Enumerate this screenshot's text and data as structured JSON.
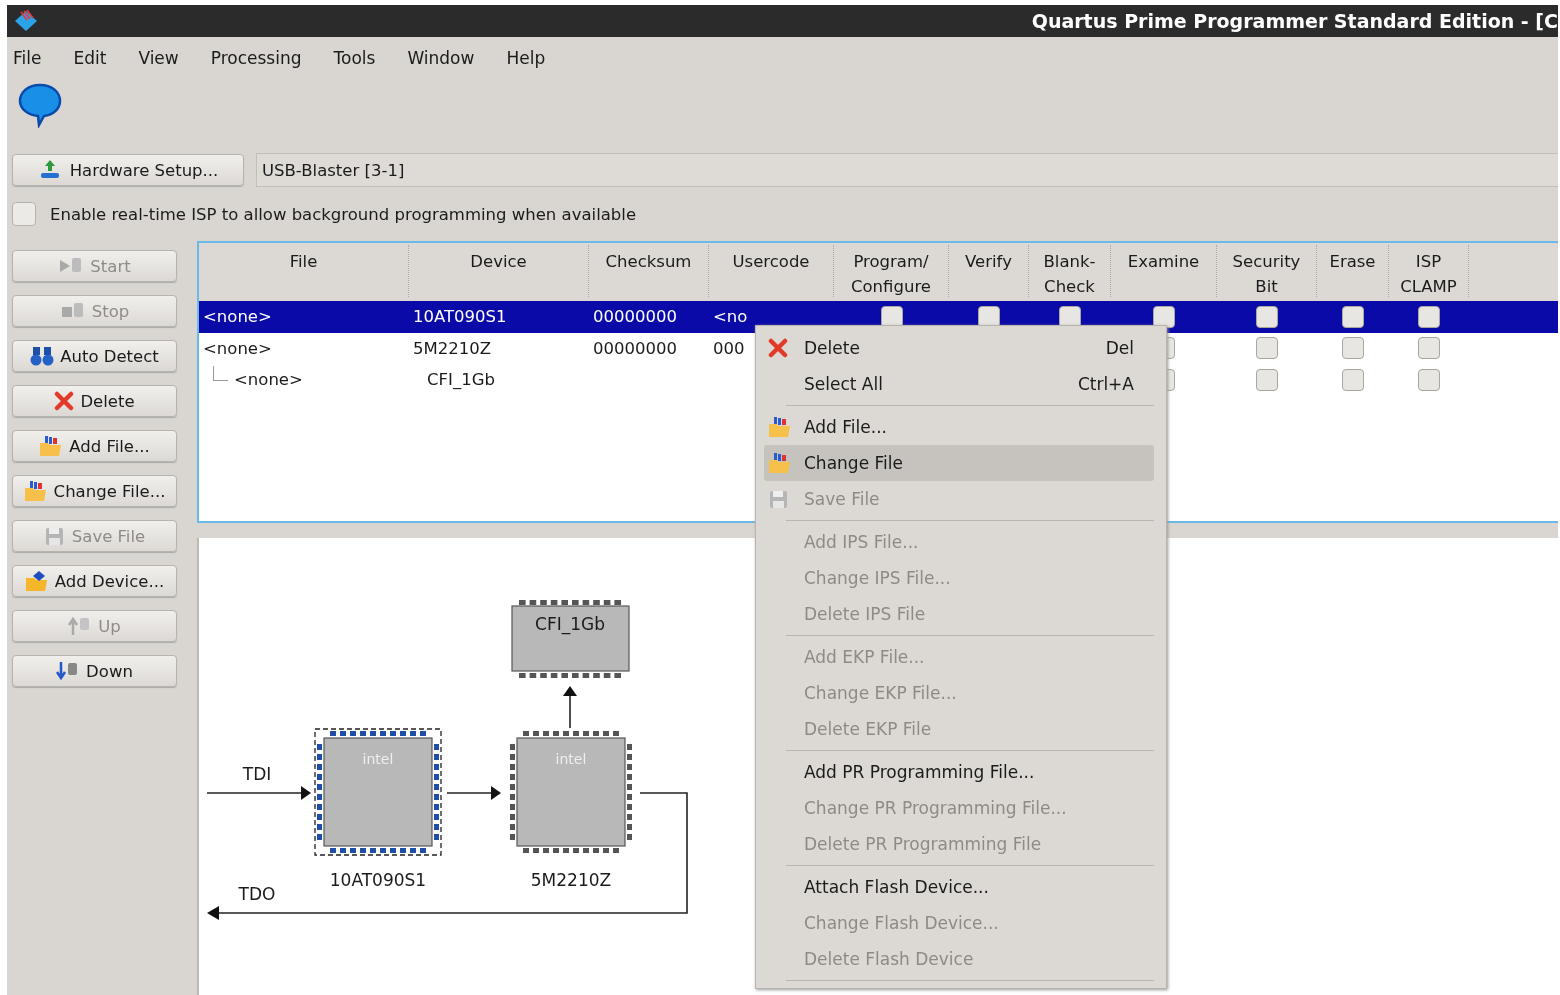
{
  "window": {
    "title": "Quartus Prime Programmer Standard Edition - [C"
  },
  "menu_bar": [
    {
      "label": "File"
    },
    {
      "label": "Edit"
    },
    {
      "label": "View"
    },
    {
      "label": "Processing"
    },
    {
      "label": "Tools"
    },
    {
      "label": "Window"
    },
    {
      "label": "Help"
    }
  ],
  "hardware": {
    "button": "Hardware Setup...",
    "value": "USB-Blaster [3-1]"
  },
  "isp_option": {
    "label": "Enable real-time ISP to allow background programming when available",
    "checked": false
  },
  "side_buttons": [
    {
      "label": "Start",
      "disabled": true
    },
    {
      "label": "Stop",
      "disabled": true
    },
    {
      "label": "Auto Detect",
      "disabled": false
    },
    {
      "label": "Delete",
      "disabled": false
    },
    {
      "label": "Add File...",
      "disabled": false
    },
    {
      "label": "Change File...",
      "disabled": false
    },
    {
      "label": "Save File",
      "disabled": true
    },
    {
      "label": "Add Device...",
      "disabled": false
    },
    {
      "label": "Up",
      "disabled": true
    },
    {
      "label": "Down",
      "disabled": false
    }
  ],
  "table": {
    "columns": [
      "File",
      "Device",
      "Checksum",
      "Usercode",
      "Program/\nConfigure",
      "Verify",
      "Blank-\nCheck",
      "Examine",
      "Security\nBit",
      "Erase",
      "ISP\nCLAMP"
    ],
    "rows": [
      {
        "file": "<none>",
        "device": "10AT090S1",
        "checksum": "00000000",
        "usercode": "<no",
        "selected": true,
        "checks": [
          false,
          false,
          false,
          false,
          false,
          false,
          false
        ],
        "children": []
      },
      {
        "file": "<none>",
        "device": "5M2210Z",
        "checksum": "00000000",
        "usercode": "000",
        "selected": false,
        "checks": [
          false,
          false,
          false,
          false
        ],
        "children": [
          {
            "file": "<none>",
            "device": "CFI_1Gb",
            "selected": false,
            "checks": [
              false,
              false,
              false,
              false
            ]
          }
        ]
      }
    ]
  },
  "diagram": {
    "signals": [
      {
        "label": "TDI"
      },
      {
        "label": "TDO"
      }
    ],
    "devices": [
      {
        "name": "10AT090S1",
        "logo": "intel",
        "selected": true
      },
      {
        "name": "5M2210Z",
        "logo": "intel",
        "selected": false
      }
    ],
    "flash": {
      "name": "CFI_1Gb"
    }
  },
  "context_menu": [
    {
      "kind": "item",
      "label": "Delete",
      "shortcut": "Del",
      "disabled": false,
      "selected": false
    },
    {
      "kind": "item",
      "label": "Select All",
      "shortcut": "Ctrl+A",
      "disabled": false,
      "selected": false
    },
    {
      "kind": "separator"
    },
    {
      "kind": "item",
      "label": "Add File...",
      "disabled": false,
      "selected": false
    },
    {
      "kind": "item",
      "label": "Change File",
      "disabled": false,
      "selected": true
    },
    {
      "kind": "item",
      "label": "Save File",
      "disabled": true,
      "selected": false
    },
    {
      "kind": "separator"
    },
    {
      "kind": "item",
      "label": "Add IPS File...",
      "disabled": true,
      "selected": false
    },
    {
      "kind": "item",
      "label": "Change IPS File...",
      "disabled": true,
      "selected": false
    },
    {
      "kind": "item",
      "label": "Delete IPS File",
      "disabled": true,
      "selected": false
    },
    {
      "kind": "separator"
    },
    {
      "kind": "item",
      "label": "Add EKP File...",
      "disabled": true,
      "selected": false
    },
    {
      "kind": "item",
      "label": "Change EKP File...",
      "disabled": true,
      "selected": false
    },
    {
      "kind": "item",
      "label": "Delete EKP File",
      "disabled": true,
      "selected": false
    },
    {
      "kind": "separator"
    },
    {
      "kind": "item",
      "label": "Add PR Programming File...",
      "disabled": false,
      "selected": false
    },
    {
      "kind": "item",
      "label": "Change PR Programming File...",
      "disabled": true,
      "selected": false
    },
    {
      "kind": "item",
      "label": "Delete PR Programming File",
      "disabled": true,
      "selected": false
    },
    {
      "kind": "separator"
    },
    {
      "kind": "item",
      "label": "Attach Flash Device...",
      "disabled": false,
      "selected": false
    },
    {
      "kind": "item",
      "label": "Change Flash Device...",
      "disabled": true,
      "selected": false
    },
    {
      "kind": "item",
      "label": "Delete Flash Device",
      "disabled": true,
      "selected": false
    },
    {
      "kind": "separator"
    }
  ]
}
